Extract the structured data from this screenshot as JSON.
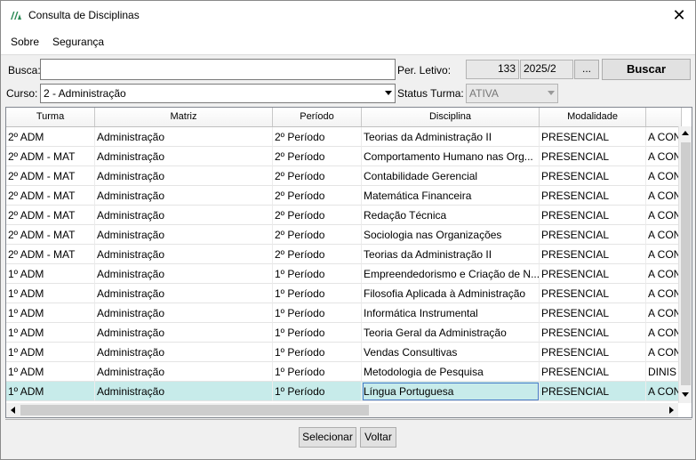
{
  "window": {
    "title": "Consulta de Disciplinas",
    "close_label": "✕"
  },
  "menu": {
    "items": [
      "Sobre",
      "Segurança"
    ]
  },
  "form": {
    "busca_label": "Busca:",
    "busca_value": "",
    "per_letivo_label": "Per. Letivo:",
    "per_letivo_code": "133",
    "per_letivo_value": "2025/2",
    "ellipsis_label": "...",
    "buscar_label": "Buscar",
    "curso_label": "Curso:",
    "curso_value": "2 - Administração",
    "status_label": "Status Turma:",
    "status_value": "ATIVA"
  },
  "grid": {
    "columns": [
      "Turma",
      "Matriz",
      "Período",
      "Disciplina",
      "Modalidade",
      ""
    ],
    "rows": [
      [
        "2º ADM",
        "Administração",
        "2º Período",
        "Teorias da Administração II",
        "PRESENCIAL",
        "A CON"
      ],
      [
        "2º ADM - MAT",
        "Administração",
        "2º Período",
        "Comportamento Humano nas Org...",
        "PRESENCIAL",
        "A CON"
      ],
      [
        "2º ADM - MAT",
        "Administração",
        "2º Período",
        "Contabilidade Gerencial",
        "PRESENCIAL",
        "A CON"
      ],
      [
        "2º ADM - MAT",
        "Administração",
        "2º Período",
        "Matemática Financeira",
        "PRESENCIAL",
        "A CON"
      ],
      [
        "2º ADM - MAT",
        "Administração",
        "2º Período",
        "Redação Técnica",
        "PRESENCIAL",
        "A CON"
      ],
      [
        "2º ADM - MAT",
        "Administração",
        "2º Período",
        "Sociologia nas Organizações",
        "PRESENCIAL",
        "A CON"
      ],
      [
        "2º ADM - MAT",
        "Administração",
        "2º Período",
        "Teorias da Administração II",
        "PRESENCIAL",
        "A CON"
      ],
      [
        "1º ADM",
        "Administração",
        "1º Período",
        "Empreendedorismo e Criação de N...",
        "PRESENCIAL",
        "A CON"
      ],
      [
        "1º ADM",
        "Administração",
        "1º Período",
        "Filosofia Aplicada à Administração",
        "PRESENCIAL",
        "A CON"
      ],
      [
        "1º ADM",
        "Administração",
        "1º Período",
        "Informática Instrumental",
        "PRESENCIAL",
        "A CON"
      ],
      [
        "1º ADM",
        "Administração",
        "1º Período",
        "Teoria Geral da Administração",
        "PRESENCIAL",
        "A CON"
      ],
      [
        "1º ADM",
        "Administração",
        "1º Período",
        "Vendas Consultivas",
        "PRESENCIAL",
        "A CON"
      ],
      [
        "1º ADM",
        "Administração",
        "1º Período",
        "Metodologia de Pesquisa",
        "PRESENCIAL",
        "DINIS"
      ],
      [
        "1º ADM",
        "Administração",
        "1º Período",
        "Língua Portuguesa",
        "PRESENCIAL",
        "A CON"
      ]
    ],
    "selected_row": 13
  },
  "footer": {
    "selecionar_label": "Selecionar",
    "voltar_label": "Voltar"
  },
  "colors": {
    "selected_row": "#c7ebea",
    "focus_border": "#4a7cc8",
    "window_bg": "#f0f0f0"
  }
}
